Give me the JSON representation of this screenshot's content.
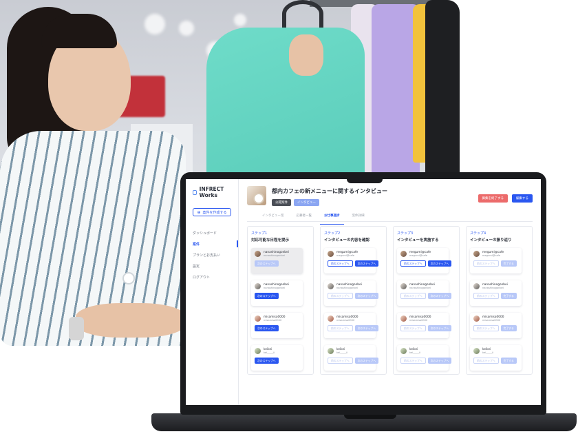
{
  "sidebar": {
    "logo": "INFRECT Works",
    "create_button": "案件を作成する",
    "nav": [
      {
        "label": "ダッシュボード",
        "active": false
      },
      {
        "label": "案件",
        "active": true
      },
      {
        "label": "プランとお支払い",
        "active": false
      },
      {
        "label": "設定",
        "active": false
      },
      {
        "label": "ログアウト",
        "active": false
      }
    ]
  },
  "project": {
    "title": "都内カフェの新メニューに関するインタビュー",
    "tags": [
      "公開案件",
      "インタビュー"
    ],
    "end_button": "募集を終了する",
    "edit_button": "編集する"
  },
  "tabs": [
    {
      "label": "インタビュー案",
      "active": false
    },
    {
      "label": "応募者一覧",
      "active": false
    },
    {
      "label": "お仕事進捗",
      "active": true
    },
    {
      "label": "案件詳細",
      "active": false
    }
  ],
  "users": [
    {
      "name": "nanashinogonbei",
      "id": "nanashinogonbei"
    },
    {
      "name": "nanashinogonbei",
      "id": "nanashinogonbei"
    },
    {
      "name": "misamisa0000",
      "id": "misamisa0000"
    },
    {
      "name": "keikei",
      "id": "kei_____ii"
    }
  ],
  "columns": [
    {
      "step": "ステップ1",
      "title": "対応可能な日程を提示",
      "cards": [
        {
          "name": "nanashinogonbei",
          "id": "nanashinogonbei",
          "selected": true,
          "buttons": [
            {
              "label": "次のステップへ",
              "style": "primary dis"
            }
          ]
        },
        {
          "name": "nanashinogonbei",
          "id": "nanashinogonbei",
          "selected": false,
          "buttons": [
            {
              "label": "次のステップへ",
              "style": "primary"
            }
          ]
        },
        {
          "name": "misamisa0000",
          "id": "misamisa0000",
          "selected": false,
          "buttons": [
            {
              "label": "次のステップへ",
              "style": "primary"
            }
          ]
        },
        {
          "name": "keikei",
          "id": "kei_____ii",
          "selected": false,
          "buttons": [
            {
              "label": "次のステップへ",
              "style": "primary"
            }
          ]
        }
      ]
    },
    {
      "step": "ステップ2",
      "title": "インタビューの内容を確認",
      "cards": [
        {
          "name": "megumi@cafe",
          "id": "megumi@cafe",
          "selected": false,
          "buttons": [
            {
              "label": "前のステップへ",
              "style": "outline"
            },
            {
              "label": "次のステップへ",
              "style": "primary"
            }
          ]
        },
        {
          "name": "nanashinogonbei",
          "id": "nanashinogonbei",
          "selected": false,
          "buttons": [
            {
              "label": "前のステップへ",
              "style": "outline dis"
            },
            {
              "label": "次のステップへ",
              "style": "primary dis"
            }
          ]
        },
        {
          "name": "misamisa0000",
          "id": "misamisa0000",
          "selected": false,
          "buttons": [
            {
              "label": "前のステップへ",
              "style": "outline dis"
            },
            {
              "label": "次のステップへ",
              "style": "primary dis"
            }
          ]
        },
        {
          "name": "keikei",
          "id": "kei_____ii",
          "selected": false,
          "buttons": [
            {
              "label": "前のステップへ",
              "style": "outline dis"
            },
            {
              "label": "次のステップへ",
              "style": "primary dis"
            }
          ]
        }
      ]
    },
    {
      "step": "ステップ3",
      "title": "インタビューを実施する",
      "cards": [
        {
          "name": "megumi@cafe",
          "id": "megumi@cafe",
          "selected": false,
          "buttons": [
            {
              "label": "前のステップへ",
              "style": "outline"
            },
            {
              "label": "次のステップへ",
              "style": "primary"
            }
          ]
        },
        {
          "name": "nanashinogonbei",
          "id": "nanashinogonbei",
          "selected": false,
          "buttons": [
            {
              "label": "前のステップへ",
              "style": "outline dis"
            },
            {
              "label": "次のステップへ",
              "style": "primary dis"
            }
          ]
        },
        {
          "name": "misamisa0000",
          "id": "misamisa0000",
          "selected": false,
          "buttons": [
            {
              "label": "前のステップへ",
              "style": "outline dis"
            },
            {
              "label": "次のステップへ",
              "style": "primary dis"
            }
          ]
        },
        {
          "name": "keikei",
          "id": "kei_____ii",
          "selected": false,
          "buttons": [
            {
              "label": "前のステップへ",
              "style": "outline dis"
            },
            {
              "label": "次のステップへ",
              "style": "primary dis"
            }
          ]
        }
      ]
    },
    {
      "step": "ステップ4",
      "title": "インタビューの振り返り",
      "cards": [
        {
          "name": "megumi@cafe",
          "id": "megumi@cafe",
          "selected": false,
          "buttons": [
            {
              "label": "前のステップへ",
              "style": "outline dis"
            },
            {
              "label": "完了する",
              "style": "primary dis"
            }
          ]
        },
        {
          "name": "nanashinogonbei",
          "id": "nanashinogonbei",
          "selected": false,
          "buttons": [
            {
              "label": "前のステップへ",
              "style": "outline dis"
            },
            {
              "label": "完了する",
              "style": "primary dis"
            }
          ]
        },
        {
          "name": "misamisa0000",
          "id": "misamisa0000",
          "selected": false,
          "buttons": [
            {
              "label": "前のステップへ",
              "style": "outline dis"
            },
            {
              "label": "完了する",
              "style": "primary dis"
            }
          ]
        },
        {
          "name": "keikei",
          "id": "kei_____ii",
          "selected": false,
          "buttons": [
            {
              "label": "前のステップへ",
              "style": "outline dis"
            },
            {
              "label": "完了する",
              "style": "primary dis"
            }
          ]
        }
      ]
    }
  ],
  "colors": {
    "accent": "#2a57f0",
    "danger": "#ec6b6b",
    "sweater": "#5fd1bf"
  }
}
